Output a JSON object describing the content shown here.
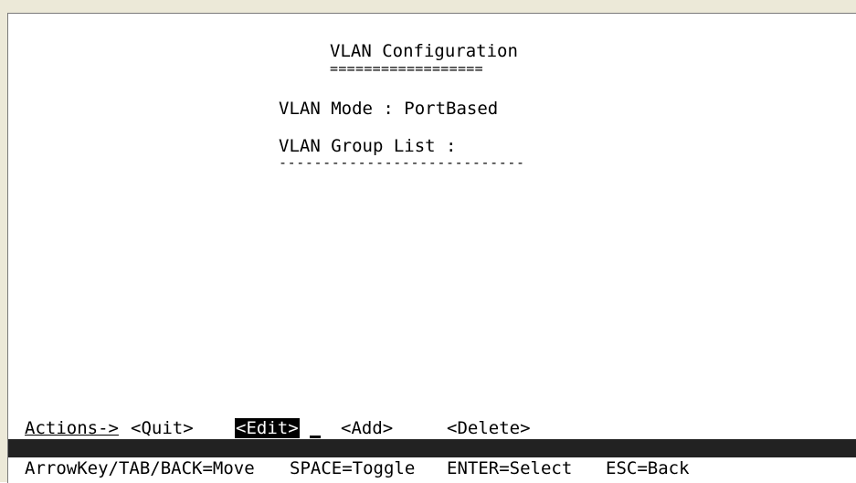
{
  "screen": {
    "title": "VLAN Configuration",
    "title_underline": "==================",
    "vlan_mode_line": "VLAN Mode : PortBased",
    "group_list_line": "VLAN Group List :",
    "group_list_underline": "----------------------------"
  },
  "actions": {
    "label": "Actions->",
    "quit": "<Quit>",
    "edit": "<Edit>",
    "add": "<Add>",
    "delete": "<Delete>",
    "selected": "edit"
  },
  "help": {
    "move": "ArrowKey/TAB/BACK=Move",
    "toggle": "SPACE=Toggle",
    "select": "ENTER=Select",
    "back": "ESC=Back"
  },
  "colors": {
    "background": "#ffffff",
    "text": "#000000",
    "highlight_bg": "#000000",
    "highlight_text": "#ffffff",
    "status_bar": "#222222"
  }
}
